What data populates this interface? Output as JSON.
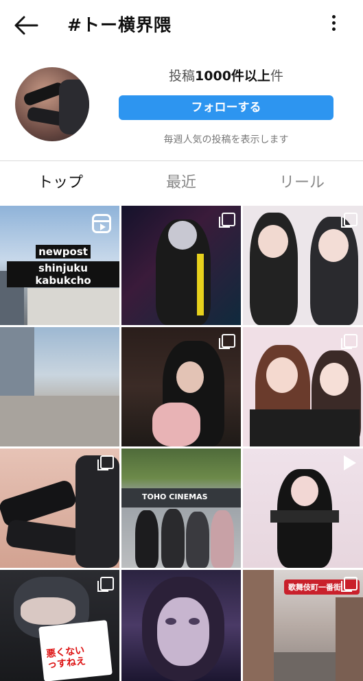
{
  "header": {
    "title": "#トー横界隈",
    "back_icon": "arrow-left-icon",
    "more_icon": "more-vertical-icon"
  },
  "profile": {
    "count_prefix": "投稿",
    "count_value": "1000件以上",
    "count_suffix": "件",
    "follow_label": "フォローする",
    "subtitle": "毎週人気の投稿を表示します"
  },
  "tabs": [
    {
      "label": "トップ",
      "active": true
    },
    {
      "label": "最近",
      "active": false
    },
    {
      "label": "リール",
      "active": false
    }
  ],
  "posts": [
    {
      "caption_line1": "newpost",
      "caption_line2": "shinjuku kabukcho",
      "icon": "reels-icon"
    },
    {
      "icon": "multiple-images-icon"
    },
    {
      "icon": "multiple-images-icon"
    },
    {
      "icon": "multiple-images-icon"
    },
    {
      "icon": "multiple-images-icon"
    },
    {
      "icon": "multiple-images-icon"
    },
    {
      "icon": "multiple-images-icon"
    },
    {
      "sign_text": "TOHO CINEMAS",
      "icon": "none"
    },
    {
      "icon": "play-icon"
    },
    {
      "sticker_line1": "悪くない",
      "sticker_line2": "っすねえ",
      "icon": "multiple-images-icon"
    },
    {
      "icon": "none"
    },
    {
      "sign_text": "歌舞伎町一番街",
      "icon": "multiple-images-icon"
    }
  ],
  "colors": {
    "accent": "#2d95f0",
    "active_tab": "#111111",
    "inactive_tab": "#888888"
  }
}
